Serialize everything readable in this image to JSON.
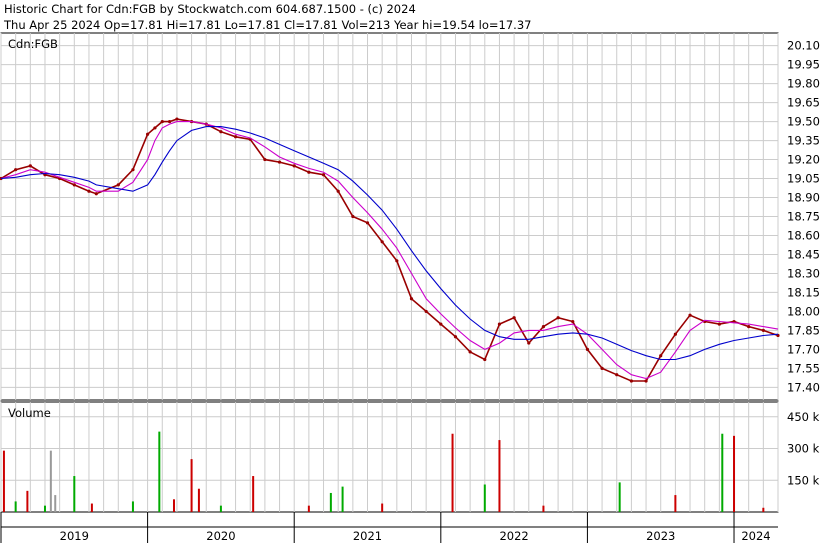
{
  "header": {
    "line1": "Historic Chart for Cdn:FGB by Stockwatch.com 604.687.1500 - (c) 2024",
    "line2": "Thu Apr 25 2024   Op=17.81   Hi=17.81   Lo=17.81   Cl=17.81   Vol=213   Year hi=19.54   lo=17.37"
  },
  "colors": {
    "price": "#990000",
    "ma_short": "#cc00cc",
    "ma_long": "#0000cc",
    "volume_up": "#00aa00",
    "volume_down": "#cc0000",
    "volume_flat": "#999999",
    "grid": "#cccccc"
  },
  "chart_data": [
    {
      "type": "line",
      "title": "Cdn:FGB",
      "ylim": [
        17.3,
        20.2
      ],
      "yticks": [
        17.4,
        17.55,
        17.7,
        17.85,
        18.0,
        18.15,
        18.3,
        18.45,
        18.6,
        18.75,
        18.9,
        19.05,
        19.2,
        19.35,
        19.5,
        19.65,
        19.8,
        19.95,
        20.1
      ],
      "ytick_labels": [
        "17.40",
        "17.55",
        "17.70",
        "17.85",
        "18.00",
        "18.15",
        "18.30",
        "18.45",
        "18.60",
        "18.75",
        "18.90",
        "19.05",
        "19.20",
        "19.35",
        "19.50",
        "19.65",
        "19.80",
        "19.95",
        "20.10"
      ],
      "xlim": [
        2019.0,
        2024.3
      ],
      "x": [
        2019.0,
        2019.1,
        2019.2,
        2019.3,
        2019.4,
        2019.5,
        2019.6,
        2019.65,
        2019.8,
        2019.9,
        2020.0,
        2020.05,
        2020.1,
        2020.15,
        2020.2,
        2020.3,
        2020.4,
        2020.5,
        2020.6,
        2020.7,
        2020.8,
        2020.9,
        2021.0,
        2021.1,
        2021.2,
        2021.3,
        2021.4,
        2021.5,
        2021.6,
        2021.7,
        2021.8,
        2021.9,
        2022.0,
        2022.1,
        2022.2,
        2022.3,
        2022.4,
        2022.5,
        2022.6,
        2022.7,
        2022.8,
        2022.9,
        2023.0,
        2023.1,
        2023.2,
        2023.3,
        2023.4,
        2023.5,
        2023.6,
        2023.7,
        2023.8,
        2023.9,
        2024.0,
        2024.1,
        2024.2,
        2024.3
      ],
      "series": [
        {
          "values": [
            19.05,
            19.12,
            19.15,
            19.08,
            19.05,
            19.0,
            18.95,
            18.93,
            19.0,
            19.12,
            19.4,
            19.45,
            19.5,
            19.5,
            19.52,
            19.5,
            19.48,
            19.42,
            19.38,
            19.36,
            19.2,
            19.18,
            19.15,
            19.1,
            19.08,
            18.95,
            18.75,
            18.7,
            18.55,
            18.4,
            18.1,
            18.0,
            17.9,
            17.8,
            17.68,
            17.62,
            17.9,
            17.95,
            17.75,
            17.88,
            17.95,
            17.92,
            17.7,
            17.55,
            17.5,
            17.45,
            17.45,
            17.65,
            17.82,
            17.97,
            17.92,
            17.9,
            17.92,
            17.88,
            17.85,
            17.81
          ]
        },
        {
          "values": [
            19.05,
            19.08,
            19.12,
            19.1,
            19.06,
            19.02,
            18.98,
            18.95,
            18.95,
            19.02,
            19.2,
            19.35,
            19.45,
            19.48,
            19.5,
            19.5,
            19.48,
            19.45,
            19.4,
            19.37,
            19.3,
            19.22,
            19.17,
            19.13,
            19.1,
            19.03,
            18.9,
            18.78,
            18.65,
            18.5,
            18.3,
            18.1,
            17.98,
            17.87,
            17.77,
            17.7,
            17.75,
            17.83,
            17.85,
            17.85,
            17.88,
            17.9,
            17.82,
            17.7,
            17.58,
            17.5,
            17.47,
            17.52,
            17.68,
            17.85,
            17.93,
            17.92,
            17.91,
            17.9,
            17.88,
            17.86
          ]
        },
        {
          "values": [
            19.05,
            19.06,
            19.08,
            19.09,
            19.08,
            19.06,
            19.03,
            19.0,
            18.97,
            18.95,
            19.0,
            19.08,
            19.18,
            19.27,
            19.35,
            19.43,
            19.46,
            19.46,
            19.44,
            19.41,
            19.37,
            19.32,
            19.27,
            19.22,
            19.17,
            19.12,
            19.03,
            18.92,
            18.8,
            18.65,
            18.48,
            18.32,
            18.18,
            18.05,
            17.94,
            17.85,
            17.8,
            17.78,
            17.78,
            17.8,
            17.82,
            17.83,
            17.82,
            17.79,
            17.74,
            17.69,
            17.65,
            17.62,
            17.62,
            17.65,
            17.7,
            17.74,
            17.77,
            17.79,
            17.81,
            17.82
          ]
        }
      ]
    },
    {
      "type": "bar",
      "title": "Volume",
      "ylim": [
        0,
        520
      ],
      "yticks": [
        150,
        300,
        450
      ],
      "ytick_labels": [
        "150 k",
        "300 k",
        "450 k"
      ],
      "xlim": [
        2019.0,
        2024.3
      ],
      "x_ticks": [
        2019.0,
        2020.0,
        2021.0,
        2022.0,
        2023.0,
        2024.0
      ],
      "x_tick_labels": [
        "2019",
        "2020",
        "2021",
        "2022",
        "2023",
        "2024"
      ],
      "bars": [
        {
          "x": 2019.02,
          "v": 290,
          "d": "down"
        },
        {
          "x": 2019.1,
          "v": 50,
          "d": "up"
        },
        {
          "x": 2019.18,
          "v": 100,
          "d": "down"
        },
        {
          "x": 2019.3,
          "v": 30,
          "d": "up"
        },
        {
          "x": 2019.34,
          "v": 290,
          "d": "flat"
        },
        {
          "x": 2019.37,
          "v": 80,
          "d": "flat"
        },
        {
          "x": 2019.5,
          "v": 170,
          "d": "up"
        },
        {
          "x": 2019.62,
          "v": 40,
          "d": "down"
        },
        {
          "x": 2019.9,
          "v": 50,
          "d": "up"
        },
        {
          "x": 2020.08,
          "v": 380,
          "d": "up"
        },
        {
          "x": 2020.18,
          "v": 60,
          "d": "down"
        },
        {
          "x": 2020.3,
          "v": 250,
          "d": "down"
        },
        {
          "x": 2020.35,
          "v": 110,
          "d": "down"
        },
        {
          "x": 2020.5,
          "v": 30,
          "d": "up"
        },
        {
          "x": 2020.72,
          "v": 170,
          "d": "down"
        },
        {
          "x": 2021.1,
          "v": 30,
          "d": "down"
        },
        {
          "x": 2021.25,
          "v": 90,
          "d": "up"
        },
        {
          "x": 2021.33,
          "v": 120,
          "d": "up"
        },
        {
          "x": 2021.6,
          "v": 40,
          "d": "down"
        },
        {
          "x": 2022.08,
          "v": 370,
          "d": "down"
        },
        {
          "x": 2022.3,
          "v": 130,
          "d": "up"
        },
        {
          "x": 2022.4,
          "v": 340,
          "d": "down"
        },
        {
          "x": 2022.7,
          "v": 30,
          "d": "down"
        },
        {
          "x": 2023.22,
          "v": 140,
          "d": "up"
        },
        {
          "x": 2023.6,
          "v": 80,
          "d": "down"
        },
        {
          "x": 2023.92,
          "v": 370,
          "d": "up"
        },
        {
          "x": 2024.0,
          "v": 360,
          "d": "down"
        },
        {
          "x": 2024.2,
          "v": 20,
          "d": "down"
        }
      ]
    }
  ]
}
